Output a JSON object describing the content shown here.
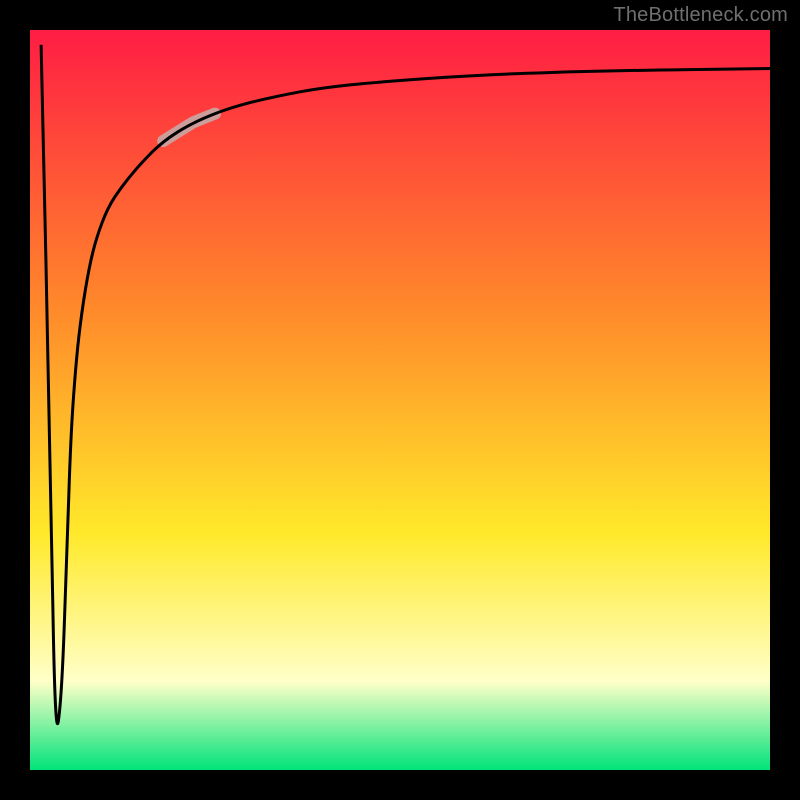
{
  "watermark": "TheBottleneck.com",
  "colors": {
    "frame": "#000000",
    "grad_top": "#ff1d44",
    "grad_mid1": "#ff8a2a",
    "grad_mid2": "#ffe92a",
    "grad_mid3": "#ffffc8",
    "grad_bottom": "#00e37a",
    "curve": "#000000",
    "highlight": "#c9a3a0"
  },
  "chart_data": {
    "type": "line",
    "title": "",
    "xlabel": "",
    "ylabel": "",
    "xlim": [
      0,
      100
    ],
    "ylim": [
      0,
      100
    ],
    "legend": false,
    "grid": false,
    "annotations": [],
    "series": [
      {
        "name": "curve",
        "x": [
          1.5,
          2.8,
          3.4,
          4.3,
          5.0,
          5.5,
          6.2,
          7.0,
          8.0,
          9.0,
          10.5,
          12.5,
          15.0,
          18.0,
          22.0,
          27.0,
          33.0,
          40.0,
          50.0,
          62.0,
          78.0,
          100.0
        ],
        "values": [
          98,
          40,
          3.5,
          10,
          30,
          45,
          55,
          62,
          68,
          72,
          76,
          79,
          82,
          85,
          87.5,
          89.5,
          91,
          92.3,
          93.2,
          94,
          94.5,
          94.8
        ]
      }
    ],
    "highlight_segment": {
      "series": "curve",
      "x_range": [
        18,
        25
      ],
      "note": "thicker pale red-grey segment on the curve"
    }
  }
}
